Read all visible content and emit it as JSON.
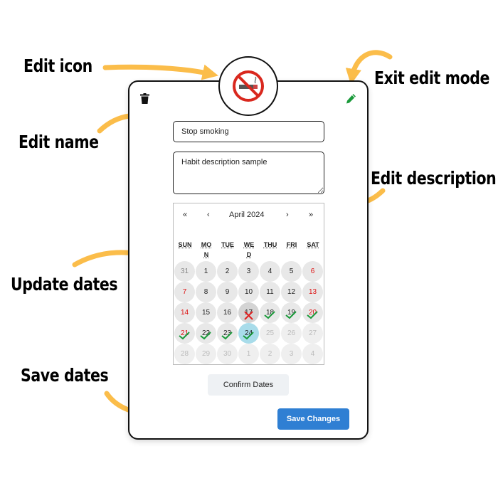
{
  "annotations": {
    "edit_icon": "Edit icon",
    "exit_edit_mode": "Exit edit mode",
    "edit_name": "Edit name",
    "edit_description": "Edit description",
    "update_dates": "Update dates",
    "save_dates": "Save dates"
  },
  "colors": {
    "arrow": "#fbbd4a",
    "save_button": "#2f7fd3",
    "today": "#a8dcea",
    "weekend": "#dd1111",
    "check": "#1a9a3a",
    "cross": "#e02020"
  },
  "habit": {
    "icon": "no-smoking-icon",
    "name": "Stop smoking",
    "description": "Habit description sample"
  },
  "calendar": {
    "month_label": "April 2024",
    "nav": {
      "prev_year": "«",
      "prev_month": "‹",
      "next_month": "›",
      "next_year": "»"
    },
    "weekdays": [
      "SUN",
      "MO\nN",
      "TUE",
      "WE\nD",
      "THU",
      "FRI",
      "SAT"
    ],
    "weeks": [
      [
        {
          "d": "31",
          "s": "prev"
        },
        {
          "d": "1"
        },
        {
          "d": "2"
        },
        {
          "d": "3"
        },
        {
          "d": "4"
        },
        {
          "d": "5"
        },
        {
          "d": "6"
        }
      ],
      [
        {
          "d": "7"
        },
        {
          "d": "8"
        },
        {
          "d": "9"
        },
        {
          "d": "10"
        },
        {
          "d": "11"
        },
        {
          "d": "12"
        },
        {
          "d": "13"
        }
      ],
      [
        {
          "d": "14"
        },
        {
          "d": "15"
        },
        {
          "d": "16"
        },
        {
          "d": "17",
          "m": "x",
          "h": true
        },
        {
          "d": "18",
          "m": "check"
        },
        {
          "d": "19",
          "m": "check"
        },
        {
          "d": "20",
          "m": "check"
        }
      ],
      [
        {
          "d": "21",
          "m": "check"
        },
        {
          "d": "22",
          "m": "check"
        },
        {
          "d": "23",
          "m": "check"
        },
        {
          "d": "24",
          "m": "check",
          "today": true
        },
        {
          "d": "25",
          "s": "future"
        },
        {
          "d": "26",
          "s": "future"
        },
        {
          "d": "27",
          "s": "future"
        }
      ],
      [
        {
          "d": "28",
          "s": "future"
        },
        {
          "d": "29",
          "s": "future"
        },
        {
          "d": "30",
          "s": "future"
        },
        {
          "d": "1",
          "s": "next"
        },
        {
          "d": "2",
          "s": "next"
        },
        {
          "d": "3",
          "s": "next"
        },
        {
          "d": "4",
          "s": "next"
        }
      ]
    ]
  },
  "buttons": {
    "confirm_dates": "Confirm Dates",
    "save_changes": "Save Changes"
  }
}
